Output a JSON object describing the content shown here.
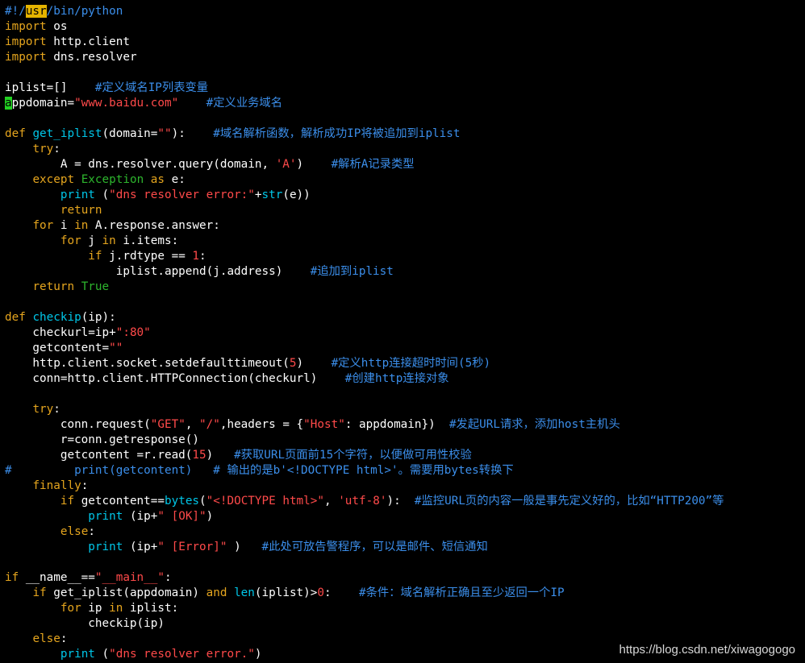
{
  "editor": {
    "lines": [
      [
        [
          "#!/",
          "cm"
        ],
        [
          "usr",
          "hl-usr"
        ],
        [
          "/bin/python",
          "cm"
        ]
      ],
      [
        [
          "import",
          "kw"
        ],
        [
          " os",
          ""
        ]
      ],
      [
        [
          "import",
          "kw"
        ],
        [
          " http.client",
          ""
        ]
      ],
      [
        [
          "import",
          "kw"
        ],
        [
          " dns.resolver",
          ""
        ]
      ],
      [],
      [
        [
          "iplist=[]    ",
          ""
        ],
        [
          "#定义域名IP列表变量",
          "cm"
        ]
      ],
      [
        [
          "a",
          "cursor"
        ],
        [
          "ppdomain=",
          ""
        ],
        [
          "\"www.baidu.com\"",
          "str"
        ],
        [
          "    ",
          ""
        ],
        [
          "#定义业务域名",
          "cm"
        ]
      ],
      [],
      [
        [
          "def",
          "kw"
        ],
        [
          " ",
          ""
        ],
        [
          "get_iplist",
          "fn"
        ],
        [
          "(domain=",
          ""
        ],
        [
          "\"\"",
          "str"
        ],
        [
          "):    ",
          ""
        ],
        [
          "#域名解析函数，解析成功IP将被追加到iplist",
          "cm"
        ]
      ],
      [
        [
          "    ",
          ""
        ],
        [
          "try",
          "kw"
        ],
        [
          ":",
          ""
        ]
      ],
      [
        [
          "        A = dns.resolver.query(domain, ",
          ""
        ],
        [
          "'A'",
          "str"
        ],
        [
          ")    ",
          ""
        ],
        [
          "#解析A记录类型",
          "cm"
        ]
      ],
      [
        [
          "    ",
          ""
        ],
        [
          "except",
          "kw"
        ],
        [
          " ",
          ""
        ],
        [
          "Exception",
          "ex"
        ],
        [
          " ",
          ""
        ],
        [
          "as",
          "kw"
        ],
        [
          " e:",
          ""
        ]
      ],
      [
        [
          "        ",
          ""
        ],
        [
          "print",
          "fn"
        ],
        [
          " (",
          ""
        ],
        [
          "\"dns resolver error:\"",
          "str"
        ],
        [
          "+",
          ""
        ],
        [
          "str",
          "fn"
        ],
        [
          "(e))",
          ""
        ]
      ],
      [
        [
          "        ",
          ""
        ],
        [
          "return",
          "kw"
        ]
      ],
      [
        [
          "    ",
          ""
        ],
        [
          "for",
          "kw"
        ],
        [
          " i ",
          ""
        ],
        [
          "in",
          "kw"
        ],
        [
          " A.response.answer:",
          ""
        ]
      ],
      [
        [
          "        ",
          ""
        ],
        [
          "for",
          "kw"
        ],
        [
          " j ",
          ""
        ],
        [
          "in",
          "kw"
        ],
        [
          " i.items:",
          ""
        ]
      ],
      [
        [
          "            ",
          ""
        ],
        [
          "if",
          "kw"
        ],
        [
          " j.rdtype == ",
          ""
        ],
        [
          "1",
          "str"
        ],
        [
          ":",
          ""
        ]
      ],
      [
        [
          "                iplist.append(j.address)    ",
          ""
        ],
        [
          "#追加到iplist",
          "cm"
        ]
      ],
      [
        [
          "    ",
          ""
        ],
        [
          "return",
          "kw"
        ],
        [
          " ",
          ""
        ],
        [
          "True",
          "ex"
        ]
      ],
      [],
      [
        [
          "def",
          "kw"
        ],
        [
          " ",
          ""
        ],
        [
          "checkip",
          "fn"
        ],
        [
          "(ip):",
          ""
        ]
      ],
      [
        [
          "    checkurl=ip+",
          ""
        ],
        [
          "\":80\"",
          "str"
        ]
      ],
      [
        [
          "    getcontent=",
          ""
        ],
        [
          "\"\"",
          "str"
        ]
      ],
      [
        [
          "    http.client.socket.setdefaulttimeout(",
          ""
        ],
        [
          "5",
          "str"
        ],
        [
          ")    ",
          ""
        ],
        [
          "#定义http连接超时时间(5秒)",
          "cm"
        ]
      ],
      [
        [
          "    conn=http.client.HTTPConnection(checkurl)    ",
          ""
        ],
        [
          "#创建http连接对象",
          "cm"
        ]
      ],
      [],
      [
        [
          "    ",
          ""
        ],
        [
          "try",
          "kw"
        ],
        [
          ":",
          ""
        ]
      ],
      [
        [
          "        conn.request(",
          ""
        ],
        [
          "\"GET\"",
          "str"
        ],
        [
          ", ",
          ""
        ],
        [
          "\"/\"",
          "str"
        ],
        [
          ",headers = {",
          ""
        ],
        [
          "\"Host\"",
          "str"
        ],
        [
          ": appdomain})  ",
          ""
        ],
        [
          "#发起URL请求，添加host主机头",
          "cm"
        ]
      ],
      [
        [
          "        r=conn.getresponse()",
          ""
        ]
      ],
      [
        [
          "        getcontent =r.read(",
          ""
        ],
        [
          "15",
          "str"
        ],
        [
          ")   ",
          ""
        ],
        [
          "#获取URL页面前15个字符，以便做可用性校验",
          "cm"
        ]
      ],
      [
        [
          "#         print(getcontent)   # 输出的是b'<!DOCTYPE html>'。需要用bytes转换下",
          "cm"
        ]
      ],
      [
        [
          "    ",
          ""
        ],
        [
          "finally",
          "kw"
        ],
        [
          ":",
          ""
        ]
      ],
      [
        [
          "        ",
          ""
        ],
        [
          "if",
          "kw"
        ],
        [
          " getcontent==",
          ""
        ],
        [
          "bytes",
          "fn"
        ],
        [
          "(",
          ""
        ],
        [
          "\"<!DOCTYPE html>\"",
          "str"
        ],
        [
          ", ",
          ""
        ],
        [
          "'utf-8'",
          "str"
        ],
        [
          "):  ",
          ""
        ],
        [
          "#监控URL页的内容一般是事先定义好的，比如“HTTP200”等",
          "cm"
        ]
      ],
      [
        [
          "            ",
          ""
        ],
        [
          "print",
          "fn"
        ],
        [
          " (ip+",
          ""
        ],
        [
          "\" [OK]\"",
          "str"
        ],
        [
          ")",
          ""
        ]
      ],
      [
        [
          "        ",
          ""
        ],
        [
          "else",
          "kw"
        ],
        [
          ":",
          ""
        ]
      ],
      [
        [
          "            ",
          ""
        ],
        [
          "print",
          "fn"
        ],
        [
          " (ip+",
          ""
        ],
        [
          "\" [Error]\"",
          "str"
        ],
        [
          " )   ",
          ""
        ],
        [
          "#此处可放告警程序，可以是邮件、短信通知",
          "cm"
        ]
      ],
      [],
      [
        [
          "if",
          "kw"
        ],
        [
          " __name__==",
          ""
        ],
        [
          "\"__main__\"",
          "str"
        ],
        [
          ":",
          ""
        ]
      ],
      [
        [
          "    ",
          ""
        ],
        [
          "if",
          "kw"
        ],
        [
          " get_iplist(appdomain) ",
          ""
        ],
        [
          "and",
          "kw"
        ],
        [
          " ",
          ""
        ],
        [
          "len",
          "fn"
        ],
        [
          "(iplist)>",
          ""
        ],
        [
          "0",
          "str"
        ],
        [
          ":    ",
          ""
        ],
        [
          "#条件：域名解析正确且至少返回一个IP",
          "cm"
        ]
      ],
      [
        [
          "        ",
          ""
        ],
        [
          "for",
          "kw"
        ],
        [
          " ip ",
          ""
        ],
        [
          "in",
          "kw"
        ],
        [
          " iplist:",
          ""
        ]
      ],
      [
        [
          "            checkip(ip)",
          ""
        ]
      ],
      [
        [
          "    ",
          ""
        ],
        [
          "else",
          "kw"
        ],
        [
          ":",
          ""
        ]
      ],
      [
        [
          "        ",
          ""
        ],
        [
          "print",
          "fn"
        ],
        [
          " (",
          ""
        ],
        [
          "\"dns resolver error.\"",
          "str"
        ],
        [
          ")",
          ""
        ]
      ]
    ]
  },
  "watermark": "https://blog.csdn.net/xiwagogogo",
  "colors": {
    "background": "#000000",
    "keyword": "#e5a51e",
    "function": "#00c6e8",
    "string": "#ff4a4a",
    "comment": "#3b8eea",
    "builtin_class": "#2db52d",
    "search_highlight": "#e5b400",
    "cursor": "#22d022"
  }
}
